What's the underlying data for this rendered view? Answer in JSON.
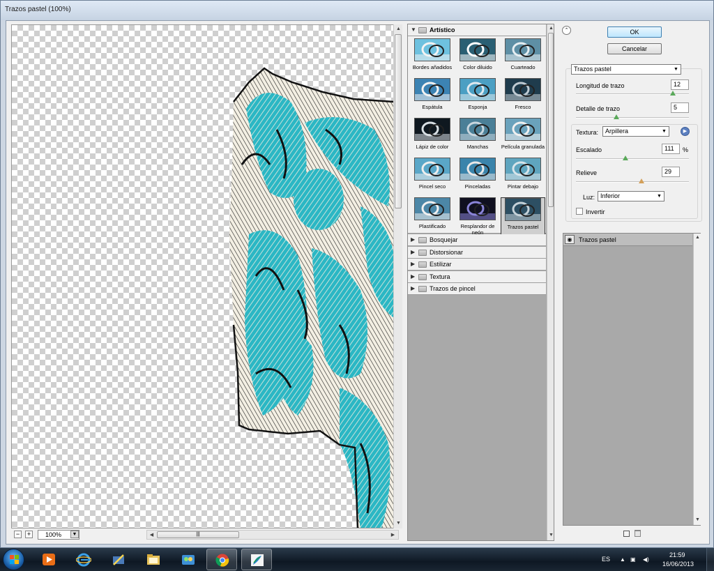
{
  "window": {
    "title": "Trazos pastel (100%)"
  },
  "preview": {
    "zoom": "100%",
    "zoom_out": "−",
    "zoom_in": "+",
    "scroll_grip": "|||"
  },
  "gallery": {
    "open_category": "Artístico",
    "filters": [
      {
        "label": "Bordes añadidos",
        "id": "bordes-anadidos"
      },
      {
        "label": "Color diluido",
        "id": "color-diluido"
      },
      {
        "label": "Cuarteado",
        "id": "cuarteado"
      },
      {
        "label": "Espátula",
        "id": "espatula"
      },
      {
        "label": "Esponja",
        "id": "esponja"
      },
      {
        "label": "Fresco",
        "id": "fresco"
      },
      {
        "label": "Lápiz de color",
        "id": "lapiz-de-color"
      },
      {
        "label": "Manchas",
        "id": "manchas"
      },
      {
        "label": "Película granulada",
        "id": "pelicula-granulada"
      },
      {
        "label": "Pincel seco",
        "id": "pincel-seco"
      },
      {
        "label": "Pinceladas",
        "id": "pinceladas"
      },
      {
        "label": "Pintar debajo",
        "id": "pintar-debajo"
      },
      {
        "label": "Plastificado",
        "id": "plastificado"
      },
      {
        "label": "Resplandor de neón",
        "id": "resplandor-de-neon"
      },
      {
        "label": "Trazos pastel",
        "id": "trazos-pastel"
      }
    ],
    "selected": "Trazos pastel",
    "categories": [
      "Bosquejar",
      "Distorsionar",
      "Estilizar",
      "Textura",
      "Trazos de pincel"
    ]
  },
  "buttons": {
    "ok": "OK",
    "cancel": "Cancelar"
  },
  "settings": {
    "filter_select": "Trazos pastel",
    "stroke_length": {
      "label": "Longitud de trazo",
      "value": "12",
      "fraction": 0.86
    },
    "stroke_detail": {
      "label": "Detalle de trazo",
      "value": "5",
      "fraction": 0.36
    },
    "texture": {
      "label": "Textura:",
      "value": "Arpillera"
    },
    "scaling": {
      "label": "Escalado",
      "value": "111",
      "unit": "%",
      "fraction": 0.44
    },
    "relief": {
      "label": "Relieve",
      "value": "29",
      "fraction": 0.58
    },
    "light": {
      "label": "Luz:",
      "value": "Inferior"
    },
    "invert": {
      "label": "Invertir",
      "checked": false
    }
  },
  "layers": {
    "items": [
      "Trazos pastel"
    ]
  },
  "taskbar": {
    "language": "ES",
    "time": "21:59",
    "date": "16/06/2013"
  },
  "icons": {
    "collapse": "double-chevron-up-icon",
    "info": "arrow-right-circle-icon",
    "eye": "eye-icon"
  }
}
